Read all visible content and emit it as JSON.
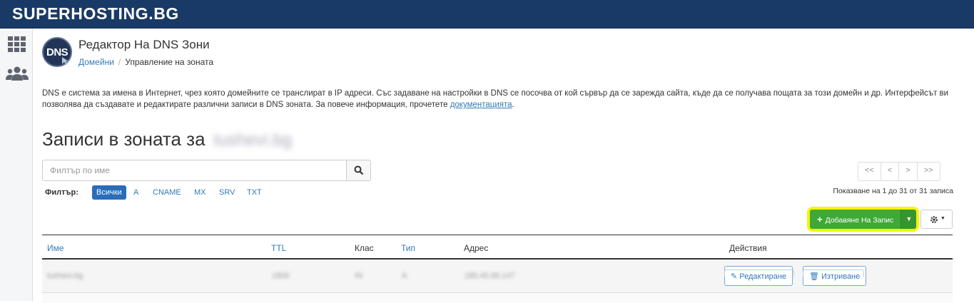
{
  "brand": "SUPERHOSTING.BG",
  "header": {
    "logo_text": "DNS",
    "title": "Редактор На DNS Зони",
    "breadcrumb": [
      "Домейни",
      "Управление на зоната"
    ]
  },
  "intro": {
    "text": "DNS е система за имена в Интернет, чрез която домейните се транслират в IP адреси. Със задаване на настройки в DNS се посочва от кой сървър да се зарежда сайта, къде да се получава пощата за този домейн и др. Интерфейсът ви позволява да създавате и редактирате различни записи в DNS зоната. За повече информация, прочетете",
    "link": "документацията",
    "suffix": "."
  },
  "records": {
    "heading": "Записи в зоната за",
    "domain": "tushevi.bg"
  },
  "search": {
    "placeholder": "Филтър по име"
  },
  "filters": {
    "label": "Филтър:",
    "items": [
      "Всички",
      "A",
      "CNAME",
      "MX",
      "SRV",
      "TXT"
    ],
    "active": "Всички"
  },
  "pagination": {
    "buttons": [
      "<<",
      "<",
      ">",
      ">>"
    ],
    "showing": "Показване на 1 до 31 от 31 записа"
  },
  "actions": {
    "add_record": "Добавяне На Запис"
  },
  "table": {
    "columns": [
      "Име",
      "TTL",
      "Клас",
      "Тип",
      "Адрес",
      "Действия"
    ],
    "rows": [
      {
        "name": "tushevi.bg",
        "ttl": "1800",
        "class": "IN",
        "type": "A",
        "address": "185.45.66.147"
      }
    ],
    "edit_label": "Редактиране",
    "delete_label": "Изтриване"
  },
  "colors": {
    "topbar": "#193a66",
    "accent": "#337ab7",
    "add_button": "#3fa836",
    "highlight": "#f4f50a"
  }
}
